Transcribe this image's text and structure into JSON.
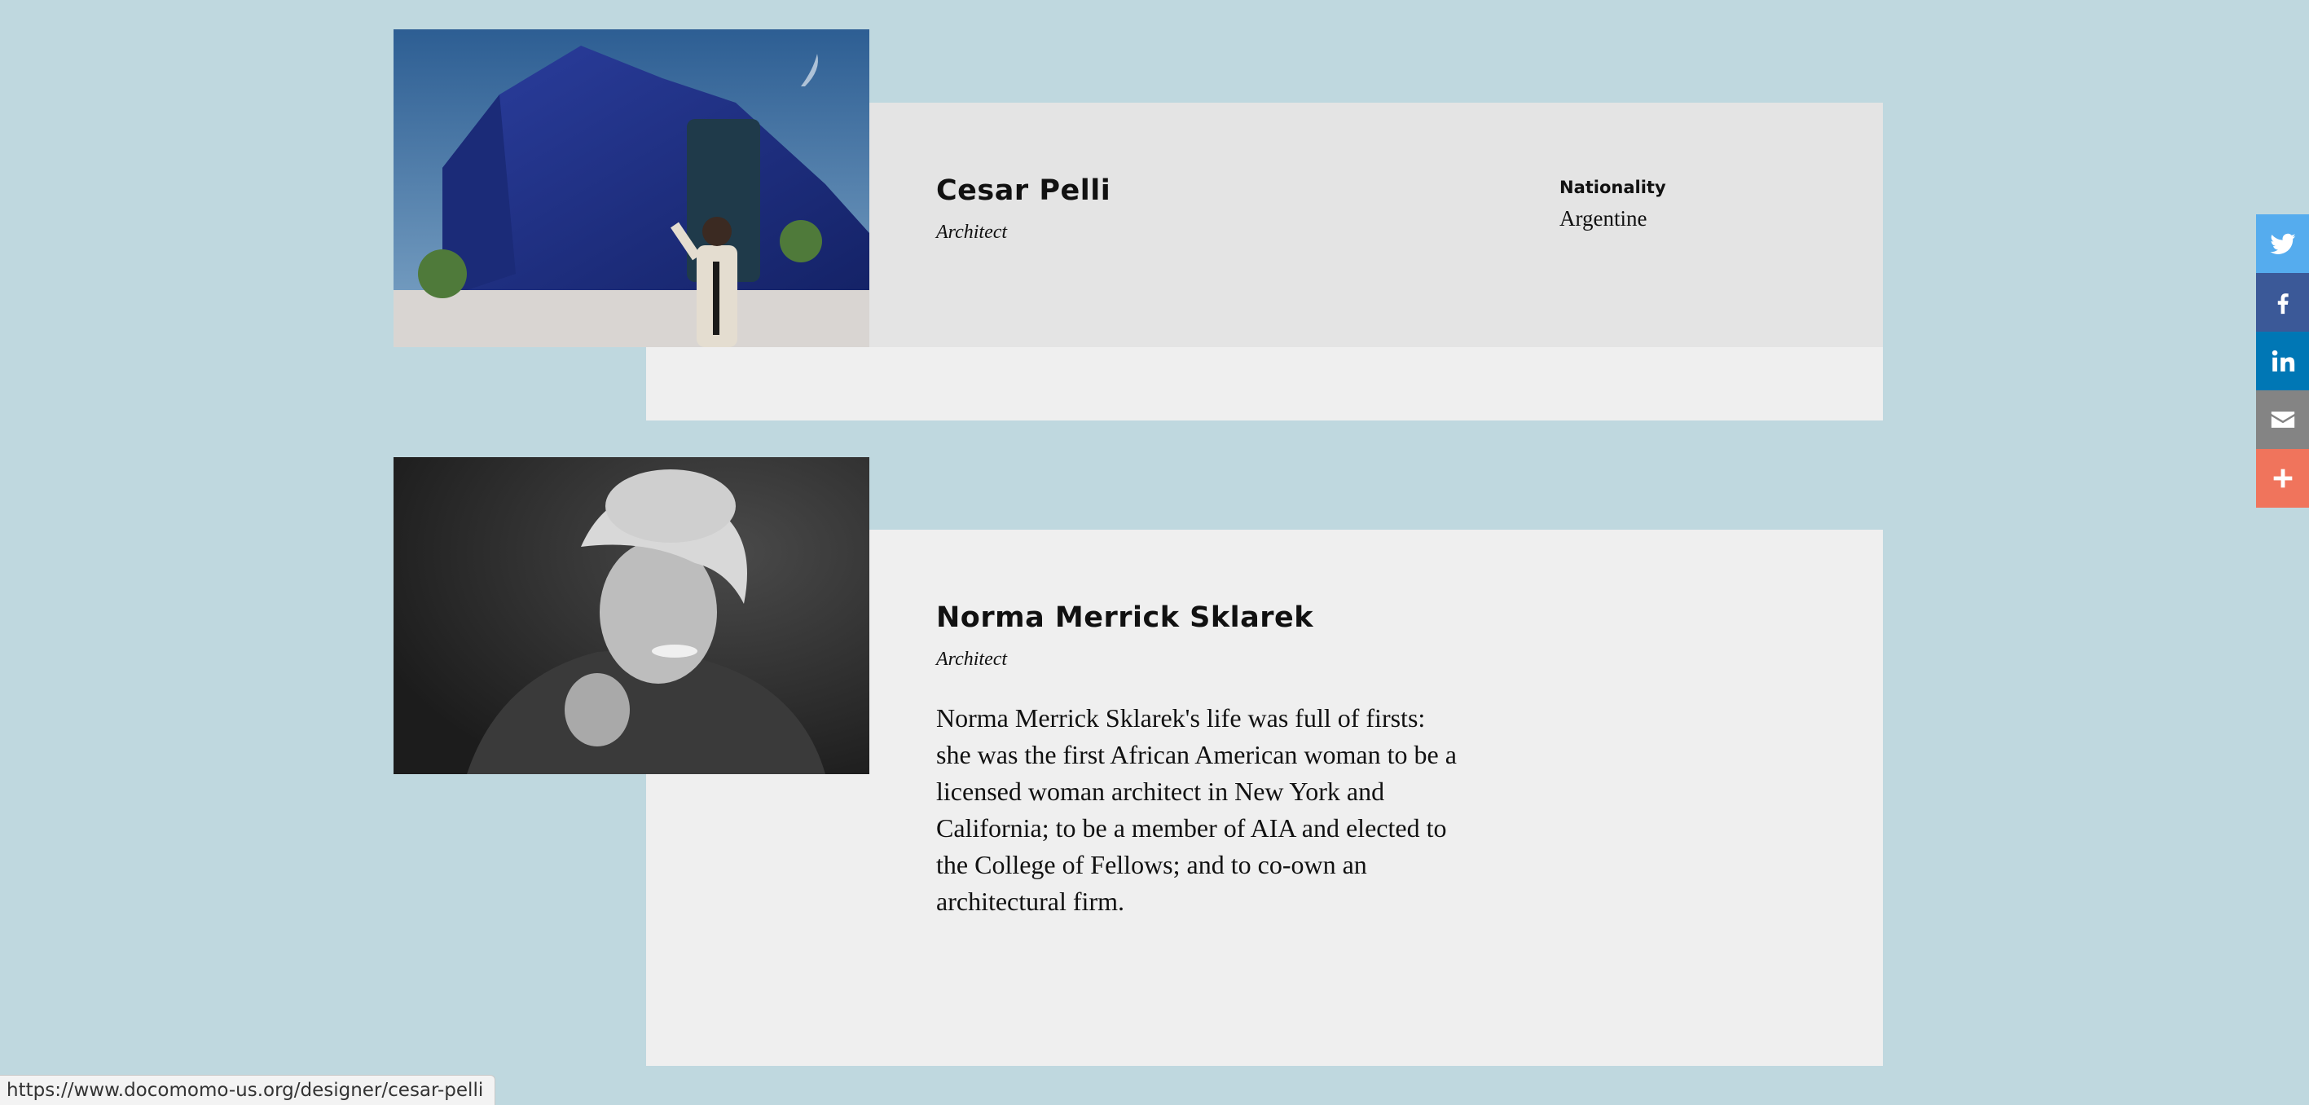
{
  "designers": [
    {
      "name": "Cesar Pelli",
      "role": "Architect",
      "meta_label": "Nationality",
      "meta_value": "Argentine",
      "photo": "photo-pelli-building"
    },
    {
      "name": "Norma Merrick Sklarek",
      "role": "Architect",
      "description": "Norma Merrick Sklarek's life was full of firsts: she was the first African American woman to be a licensed woman architect in New York and California; to be a member of AIA and elected to the College of Fellows; and to co-own an architectural firm.",
      "photo": "photo-sklarek-portrait"
    }
  ],
  "share_bar": [
    {
      "icon": "twitter-icon",
      "color": "#55acee"
    },
    {
      "icon": "facebook-icon",
      "color": "#3b5998"
    },
    {
      "icon": "linkedin-icon",
      "color": "#0077b5"
    },
    {
      "icon": "email-icon",
      "color": "#848484"
    },
    {
      "icon": "plus-icon",
      "color": "#f0745c"
    }
  ],
  "status_bar": {
    "url": "https://www.docomomo-us.org/designer/cesar-pelli"
  },
  "colors": {
    "page_background": "#bfd8df",
    "card_panel": "#efefef",
    "card_panel_hover": "#e4e4e4"
  }
}
